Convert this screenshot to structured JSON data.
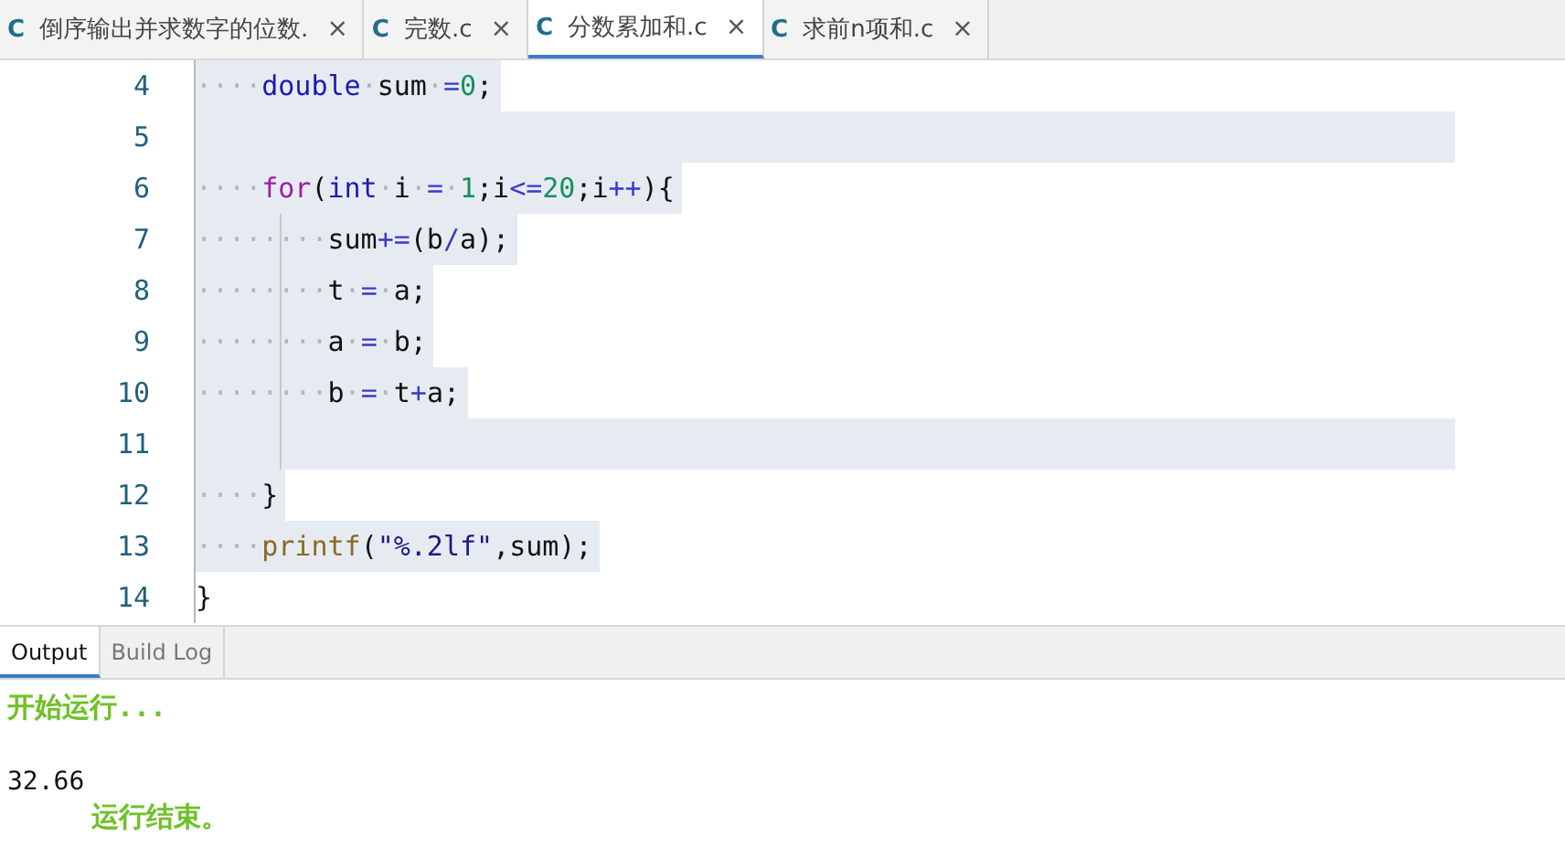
{
  "tabs": [
    {
      "icon": "C",
      "label": "倒序输出并求数字的位数.",
      "close": "×",
      "selected": false
    },
    {
      "icon": "C",
      "label": "完数.c",
      "close": "×",
      "selected": false
    },
    {
      "icon": "C",
      "label": "分数累加和.c",
      "close": "×",
      "selected": true
    },
    {
      "icon": "C",
      "label": "求前n项和.c",
      "close": "×",
      "selected": false
    }
  ],
  "editor": {
    "lines": [
      {
        "number": "4",
        "selected": true,
        "guide": false,
        "tokens": [
          {
            "kind": "ws",
            "text": "····"
          },
          {
            "kind": "type",
            "text": "double"
          },
          {
            "kind": "ws",
            "text": "·"
          },
          {
            "kind": "plain",
            "text": "sum"
          },
          {
            "kind": "ws",
            "text": "·"
          },
          {
            "kind": "op",
            "text": "="
          },
          {
            "kind": "number",
            "text": "0"
          },
          {
            "kind": "plain",
            "text": ";"
          }
        ]
      },
      {
        "number": "5",
        "selected": true,
        "guide": false
      },
      {
        "number": "6",
        "selected": true,
        "guide": false,
        "tokens": [
          {
            "kind": "ws",
            "text": "····"
          },
          {
            "kind": "keyword",
            "text": "for"
          },
          {
            "kind": "plain",
            "text": "("
          },
          {
            "kind": "type",
            "text": "int"
          },
          {
            "kind": "ws",
            "text": "·"
          },
          {
            "kind": "plain",
            "text": "i"
          },
          {
            "kind": "ws",
            "text": "·"
          },
          {
            "kind": "op",
            "text": "="
          },
          {
            "kind": "ws",
            "text": "·"
          },
          {
            "kind": "number",
            "text": "1"
          },
          {
            "kind": "plain",
            "text": ";i"
          },
          {
            "kind": "op",
            "text": "<="
          },
          {
            "kind": "number",
            "text": "20"
          },
          {
            "kind": "plain",
            "text": ";i"
          },
          {
            "kind": "op",
            "text": "++"
          },
          {
            "kind": "plain",
            "text": "){"
          }
        ]
      },
      {
        "number": "7",
        "selected": true,
        "guide": true,
        "tokens": [
          {
            "kind": "ws",
            "text": "········"
          },
          {
            "kind": "plain",
            "text": "sum"
          },
          {
            "kind": "op",
            "text": "+="
          },
          {
            "kind": "plain",
            "text": "(b"
          },
          {
            "kind": "op",
            "text": "/"
          },
          {
            "kind": "plain",
            "text": "a);"
          }
        ]
      },
      {
        "number": "8",
        "selected": true,
        "guide": true,
        "tokens": [
          {
            "kind": "ws",
            "text": "········"
          },
          {
            "kind": "plain",
            "text": "t"
          },
          {
            "kind": "ws",
            "text": "·"
          },
          {
            "kind": "op",
            "text": "="
          },
          {
            "kind": "ws",
            "text": "·"
          },
          {
            "kind": "plain",
            "text": "a;"
          }
        ]
      },
      {
        "number": "9",
        "selected": true,
        "guide": true,
        "tokens": [
          {
            "kind": "ws",
            "text": "········"
          },
          {
            "kind": "plain",
            "text": "a"
          },
          {
            "kind": "ws",
            "text": "·"
          },
          {
            "kind": "op",
            "text": "="
          },
          {
            "kind": "ws",
            "text": "·"
          },
          {
            "kind": "plain",
            "text": "b;"
          }
        ]
      },
      {
        "number": "10",
        "selected": true,
        "guide": true,
        "tokens": [
          {
            "kind": "ws",
            "text": "········"
          },
          {
            "kind": "plain",
            "text": "b"
          },
          {
            "kind": "ws",
            "text": "·"
          },
          {
            "kind": "op",
            "text": "="
          },
          {
            "kind": "ws",
            "text": "·"
          },
          {
            "kind": "plain",
            "text": "t"
          },
          {
            "kind": "op",
            "text": "+"
          },
          {
            "kind": "plain",
            "text": "a;"
          }
        ]
      },
      {
        "number": "11",
        "selected": true,
        "guide": true
      },
      {
        "number": "12",
        "selected": true,
        "guide": false,
        "tokens": [
          {
            "kind": "ws",
            "text": "····"
          },
          {
            "kind": "plain",
            "text": "}"
          }
        ]
      },
      {
        "number": "13",
        "selected": true,
        "guide": false,
        "tokens": [
          {
            "kind": "ws",
            "text": "····"
          },
          {
            "kind": "func",
            "text": "printf"
          },
          {
            "kind": "plain",
            "text": "("
          },
          {
            "kind": "string",
            "text": "\"%.2lf\""
          },
          {
            "kind": "plain",
            "text": ",sum);"
          }
        ]
      },
      {
        "number": "14",
        "selected": false,
        "guide": false,
        "tokens": [
          {
            "kind": "plain",
            "text": "}"
          }
        ]
      }
    ]
  },
  "output_tabs": [
    {
      "label": "Output",
      "selected": true
    },
    {
      "label": "Build Log",
      "selected": false
    }
  ],
  "output": [
    {
      "kind": "status",
      "text": "开始运行..."
    },
    {
      "kind": "result",
      "text": "32.66"
    },
    {
      "kind": "status_indented",
      "text": "运行结束。"
    }
  ]
}
